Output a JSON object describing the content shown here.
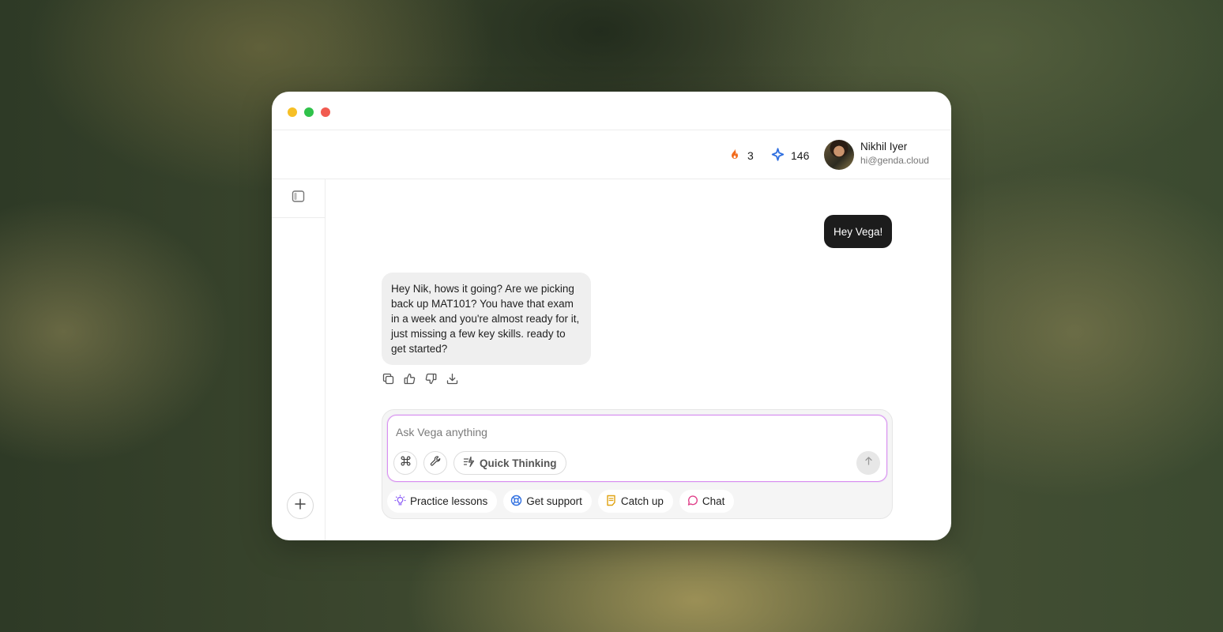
{
  "window": {
    "controls": [
      "minimize",
      "maximize",
      "close"
    ]
  },
  "header": {
    "streak": {
      "icon": "flame-icon",
      "value": "3",
      "color": "#f26b1d"
    },
    "points": {
      "icon": "sparkle-icon",
      "value": "146",
      "color": "#2f6fe0"
    },
    "user": {
      "name": "Nikhil Iyer",
      "email": "hi@genda.cloud"
    }
  },
  "sidebar": {
    "toggle_icon": "sidebar-toggle-icon",
    "new_icon": "plus-icon"
  },
  "messages": {
    "user_message": "Hey Vega!",
    "assistant_message": "Hey Nik, hows it going? Are we picking back up MAT101? You have that exam in a week and you're almost ready for it, just missing a few key skills. ready to get started?"
  },
  "message_actions": [
    "copy-icon",
    "thumbs-up-icon",
    "thumbs-down-icon",
    "download-icon"
  ],
  "composer": {
    "placeholder": "Ask Vega anything",
    "quick_label": "Quick Thinking",
    "accent_border": "#d98ef0"
  },
  "suggestions": [
    {
      "label": "Practice lessons",
      "icon": "lightbulb-icon",
      "color": "#8b5cf6"
    },
    {
      "label": "Get support",
      "icon": "lifebuoy-icon",
      "color": "#2f6fe0"
    },
    {
      "label": "Catch up",
      "icon": "note-icon",
      "color": "#e0a312"
    },
    {
      "label": "Chat",
      "icon": "chat-bubble-icon",
      "color": "#e0408a"
    }
  ]
}
